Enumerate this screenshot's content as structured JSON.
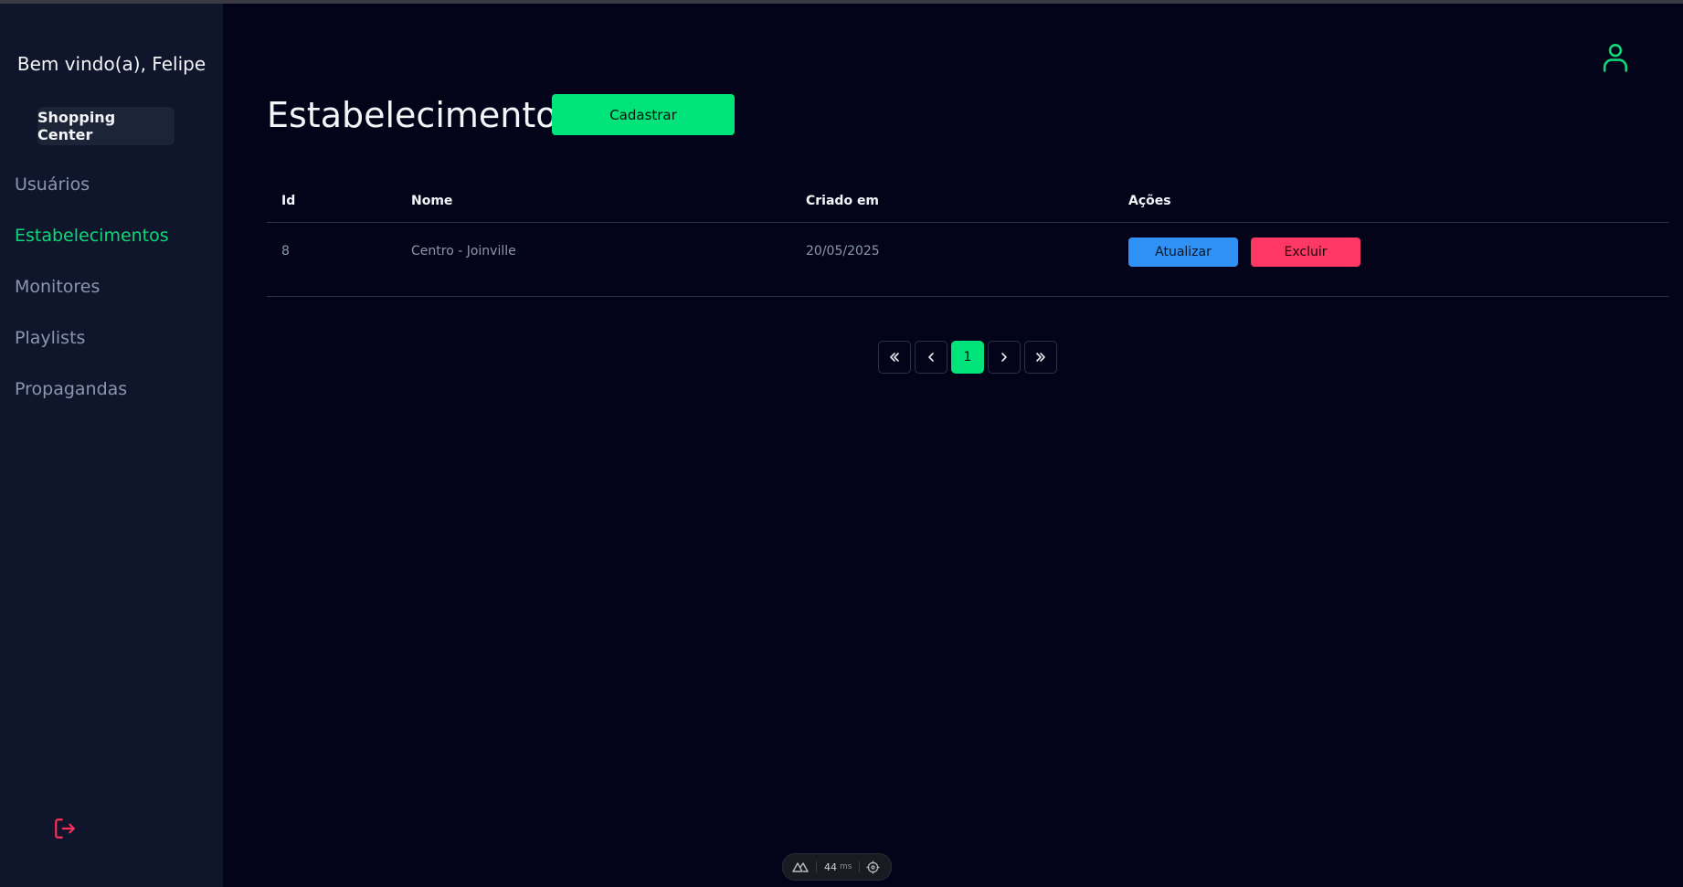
{
  "sidebar": {
    "welcome": "Bem vindo(a), Felipe",
    "context": "Shopping Center",
    "items": [
      {
        "label": "Usuários"
      },
      {
        "label": "Estabelecimentos"
      },
      {
        "label": "Monitores"
      },
      {
        "label": "Playlists"
      },
      {
        "label": "Propagandas"
      }
    ],
    "active_item": "Estabelecimentos",
    "logout_icon": "logout-icon"
  },
  "header": {
    "title": "Estabelecimentos",
    "create_label": "Cadastrar",
    "user_icon": "user-icon"
  },
  "table": {
    "columns": [
      "Id",
      "Nome",
      "Criado em",
      "Ações"
    ],
    "rows": [
      {
        "id": "8",
        "nome": "Centro - Joinville",
        "criado_em": "20/05/2025",
        "update_label": "Atualizar",
        "delete_label": "Excluir"
      }
    ]
  },
  "pagination": {
    "current_page": "1",
    "first_icon": "double-chevron-left-icon",
    "prev_icon": "chevron-left-icon",
    "next_icon": "chevron-right-icon",
    "last_icon": "double-chevron-right-icon"
  },
  "dev_indicator": {
    "value": "44",
    "unit": "ms"
  },
  "colors": {
    "background": "#03041a",
    "sidebar": "#0f152b",
    "accent": "#00e37a",
    "update": "#3192f5",
    "delete": "#ff3864"
  }
}
